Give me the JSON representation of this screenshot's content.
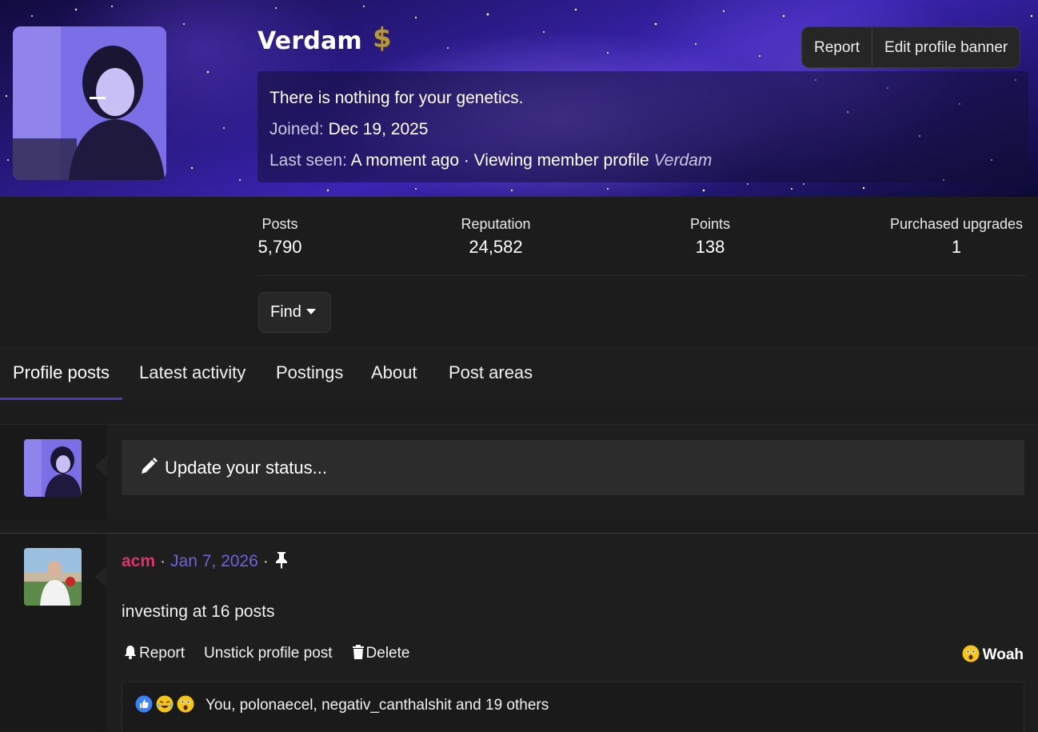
{
  "profile": {
    "username": "Verdam",
    "badge_icon": "dollar-icon",
    "badge_glyph": "$",
    "status_quote": "There is nothing for your genetics.",
    "joined_label": "Joined:",
    "joined_value": "Dec 19, 2025",
    "last_seen_label": "Last seen:",
    "last_seen_value": "A moment ago · Viewing member profile",
    "last_seen_target": "Verdam"
  },
  "banner_actions": {
    "report_label": "Report",
    "edit_banner_label": "Edit profile banner"
  },
  "stats": {
    "posts_label": "Posts",
    "posts_value": "5,790",
    "reputation_label": "Reputation",
    "reputation_value": "24,582",
    "points_label": "Points",
    "points_value": "138",
    "upgrades_label": "Purchased upgrades",
    "upgrades_value": "1"
  },
  "find": {
    "label": "Find"
  },
  "tabs": {
    "profile_posts": "Profile posts",
    "latest_activity": "Latest activity",
    "postings": "Postings",
    "about": "About",
    "post_areas": "Post areas"
  },
  "composer": {
    "placeholder": "Update your status..."
  },
  "post": {
    "author": "acm",
    "date": "Jan 7, 2026",
    "separator": "·",
    "text": "investing at 16 posts",
    "actions": {
      "report": "Report",
      "unstick": "Unstick profile post",
      "delete": "Delete"
    },
    "reaction_label": "Woah",
    "reactions_summary": "You, polonaecel, negativ_canthalshit and 19 others"
  },
  "colors": {
    "accent": "#4a3cb8",
    "author": "#e0306e",
    "date": "#6f62d8",
    "badge": "#b6963c"
  }
}
